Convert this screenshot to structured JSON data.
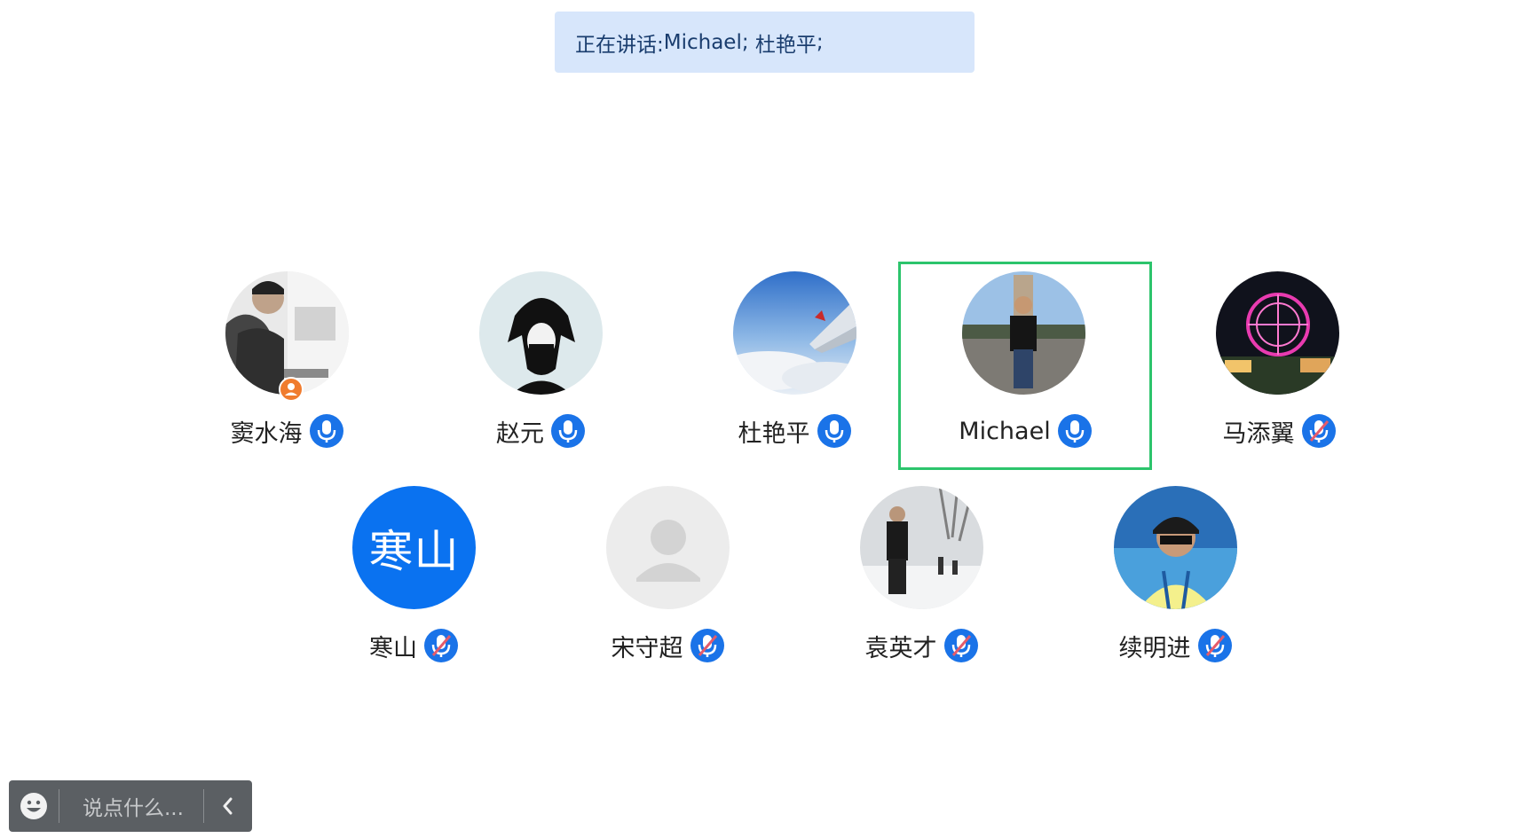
{
  "banner": {
    "prefix": "正在讲话: ",
    "speakers": [
      "Michael",
      "杜艳平"
    ],
    "separator": "; ",
    "suffix": ";"
  },
  "participants": [
    {
      "name": "窦水海",
      "mic": "on",
      "avatar": "photo-man-collage",
      "host": true
    },
    {
      "name": "赵元",
      "mic": "on",
      "avatar": "photo-ink-portrait"
    },
    {
      "name": "杜艳平",
      "mic": "on",
      "avatar": "photo-airplane-wing"
    },
    {
      "name": "Michael",
      "mic": "on",
      "avatar": "photo-man-square",
      "active": true
    },
    {
      "name": "马添翼",
      "mic": "muted",
      "avatar": "photo-ferris-wheel"
    },
    {
      "name": "寒山",
      "mic": "muted",
      "avatar": "initials",
      "initials": "寒山"
    },
    {
      "name": "宋守超",
      "mic": "muted",
      "avatar": "default-user"
    },
    {
      "name": "袁英才",
      "mic": "muted",
      "avatar": "photo-man-snow"
    },
    {
      "name": "续明进",
      "mic": "muted",
      "avatar": "photo-man-cap"
    }
  ],
  "chat": {
    "placeholder": "说点什么...",
    "emoji_icon": "smiley-icon",
    "collapse_icon": "chevron-left-icon"
  },
  "colors": {
    "banner_bg": "#d7e6fb",
    "banner_text": "#1a3d6e",
    "active_border": "#2cc46c",
    "mic_blue": "#1a73e8",
    "mute_slash": "#e45b6b",
    "initials_bg": "#0a72f0",
    "host_badge": "#f07c2e",
    "chat_bg": "#5b5f63"
  }
}
